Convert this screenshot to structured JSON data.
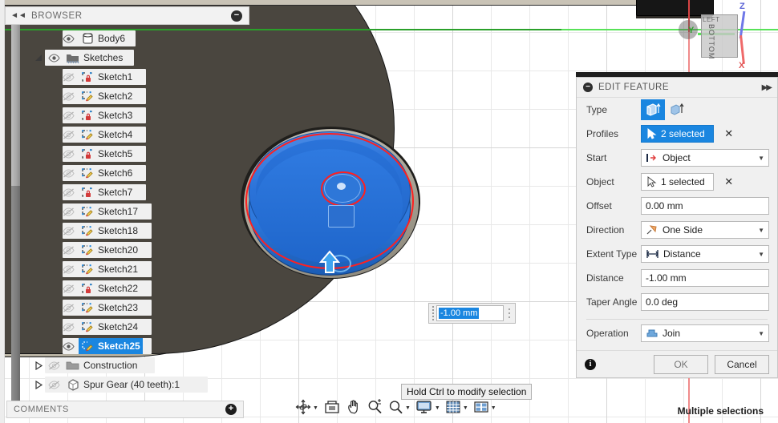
{
  "browser": {
    "title": "BROWSER",
    "collapse_icon": "double-chevron-left-icon",
    "minimize_icon": "minus-circle-icon",
    "items": [
      {
        "label": "Body6",
        "icon": "body-icon",
        "eye": "visible",
        "indent": 1,
        "expander": false,
        "selected": false
      },
      {
        "label": "Sketches",
        "icon": "sketches-folder-icon",
        "eye": "visible",
        "indent": 0,
        "expander": true,
        "selected": false
      },
      {
        "label": "Sketch1",
        "icon": "sketch-locked-icon",
        "eye": "hidden",
        "indent": 1,
        "expander": false,
        "selected": false
      },
      {
        "label": "Sketch2",
        "icon": "sketch-editable-icon",
        "eye": "hidden",
        "indent": 1,
        "expander": false,
        "selected": false
      },
      {
        "label": "Sketch3",
        "icon": "sketch-locked-icon",
        "eye": "hidden",
        "indent": 1,
        "expander": false,
        "selected": false
      },
      {
        "label": "Sketch4",
        "icon": "sketch-editable-icon",
        "eye": "hidden",
        "indent": 1,
        "expander": false,
        "selected": false
      },
      {
        "label": "Sketch5",
        "icon": "sketch-locked-icon",
        "eye": "hidden",
        "indent": 1,
        "expander": false,
        "selected": false
      },
      {
        "label": "Sketch6",
        "icon": "sketch-editable-icon",
        "eye": "hidden",
        "indent": 1,
        "expander": false,
        "selected": false
      },
      {
        "label": "Sketch7",
        "icon": "sketch-locked-icon",
        "eye": "hidden",
        "indent": 1,
        "expander": false,
        "selected": false
      },
      {
        "label": "Sketch17",
        "icon": "sketch-editable-icon",
        "eye": "hidden",
        "indent": 1,
        "expander": false,
        "selected": false
      },
      {
        "label": "Sketch18",
        "icon": "sketch-editable-icon",
        "eye": "hidden",
        "indent": 1,
        "expander": false,
        "selected": false
      },
      {
        "label": "Sketch20",
        "icon": "sketch-editable-icon",
        "eye": "hidden",
        "indent": 1,
        "expander": false,
        "selected": false
      },
      {
        "label": "Sketch21",
        "icon": "sketch-editable-icon",
        "eye": "hidden",
        "indent": 1,
        "expander": false,
        "selected": false
      },
      {
        "label": "Sketch22",
        "icon": "sketch-locked-icon",
        "eye": "hidden",
        "indent": 1,
        "expander": false,
        "selected": false
      },
      {
        "label": "Sketch23",
        "icon": "sketch-editable-icon",
        "eye": "hidden",
        "indent": 1,
        "expander": false,
        "selected": false
      },
      {
        "label": "Sketch24",
        "icon": "sketch-editable-icon",
        "eye": "hidden",
        "indent": 1,
        "expander": false,
        "selected": false
      },
      {
        "label": "Sketch25",
        "icon": "sketch-editable-icon",
        "eye": "visible",
        "indent": 1,
        "expander": false,
        "selected": true
      },
      {
        "label": "Construction",
        "icon": "folder-icon",
        "eye": "hidden",
        "indent": 0,
        "expander": true,
        "selected": false
      },
      {
        "label": "Spur Gear (40 teeth):1",
        "icon": "component-icon",
        "eye": "hidden",
        "indent": 0,
        "expander": true,
        "selected": false
      }
    ]
  },
  "edit_feature": {
    "title": "EDIT FEATURE",
    "collapse_icon": "minus-circle-icon",
    "expand_icon": "double-chevron-right-icon",
    "rows": {
      "type": {
        "label": "Type",
        "option1_icon": "extrude-profile-icon",
        "option2_icon": "extrude-surface-icon",
        "selected_index": 0
      },
      "profiles": {
        "label": "Profiles",
        "value": "2 selected",
        "cursor_icon": "select-arrow-icon",
        "clear_icon": "clear-x-icon"
      },
      "start": {
        "label": "Start",
        "value": "Object",
        "icon": "start-object-icon",
        "caret": "chevron-down-icon"
      },
      "object": {
        "label": "Object",
        "value": "1 selected",
        "cursor_icon": "select-arrow-icon",
        "clear_icon": "clear-x-icon"
      },
      "offset": {
        "label": "Offset",
        "value": "0.00 mm"
      },
      "direction": {
        "label": "Direction",
        "value": "One Side",
        "icon": "direction-one-side-icon",
        "caret": "chevron-down-icon"
      },
      "extent_type": {
        "label": "Extent Type",
        "value": "Distance",
        "icon": "distance-icon",
        "caret": "chevron-down-icon"
      },
      "distance": {
        "label": "Distance",
        "value": "-1.00 mm"
      },
      "taper_angle": {
        "label": "Taper Angle",
        "value": "0.0 deg"
      },
      "operation": {
        "label": "Operation",
        "value": "Join",
        "icon": "join-operation-icon",
        "caret": "chevron-down-icon"
      }
    },
    "footer": {
      "info_icon": "info-icon",
      "ok_label": "OK",
      "cancel_label": "Cancel"
    }
  },
  "canvas": {
    "dimension_input": {
      "value": "-1.00 mm",
      "grip_icon": "drag-grip-icon",
      "menu_icon": "more-options-icon"
    },
    "tooltip": "Hold Ctrl to modify selection",
    "arrow_icon": "extrude-direction-arrow-icon",
    "viewcube": {
      "face_top_label": "LEFT",
      "face_label": "BOTTOM",
      "axis_z": "Z",
      "axis_y": "Y",
      "axis_x": "X"
    }
  },
  "comments": {
    "title": "COMMENTS",
    "add_icon": "plus-circle-icon"
  },
  "navbar": {
    "items": [
      {
        "icon": "orbit-icon",
        "caret": true
      },
      {
        "icon": "look-at-icon",
        "caret": false
      },
      {
        "icon": "pan-icon",
        "caret": false
      },
      {
        "icon": "zoom-icon",
        "caret": false
      },
      {
        "icon": "zoom-window-icon",
        "caret": true
      },
      {
        "icon": "display-settings-icon",
        "caret": true
      },
      {
        "icon": "grid-snap-icon",
        "caret": true
      },
      {
        "icon": "viewports-icon",
        "caret": true
      }
    ]
  },
  "status": {
    "right_text": "Multiple selections"
  },
  "colors": {
    "accent": "#1a86e0",
    "profile_red": "#ff2020",
    "axis_green": "#2aa02a",
    "body_blue": "#2a72d8"
  }
}
